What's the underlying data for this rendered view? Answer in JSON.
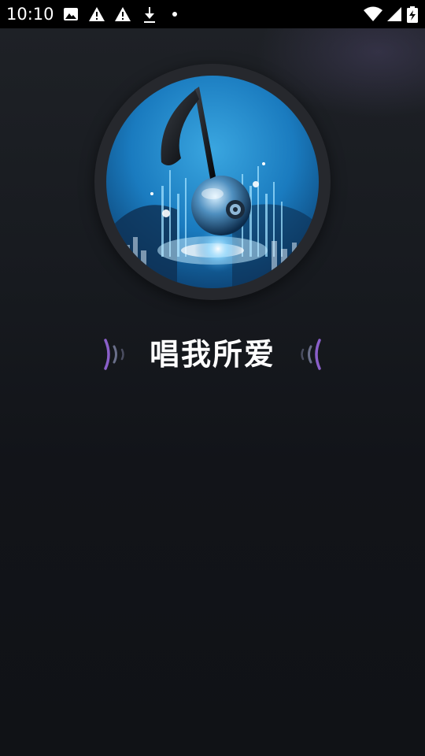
{
  "status_bar": {
    "time": "10:10",
    "left_icons": [
      "image-icon",
      "warning-icon",
      "warning-icon",
      "download-icon",
      "dot-icon"
    ],
    "right_icons": [
      "wifi-icon",
      "cellular-signal-icon",
      "battery-charging-icon"
    ]
  },
  "splash": {
    "title": "唱我所爱",
    "cover_icon": "music-note-speaker-art",
    "colors": {
      "background": "#121419",
      "accent_blue": "#1f8fd6",
      "wave_purple": "#8a5fc9"
    }
  }
}
